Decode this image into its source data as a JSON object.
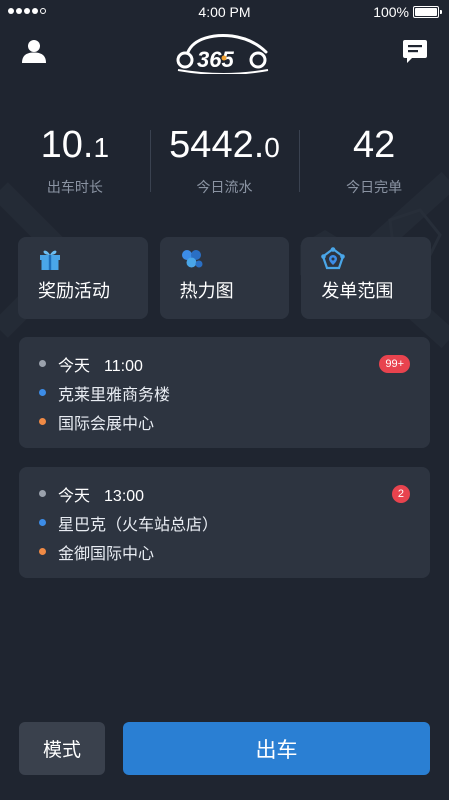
{
  "status_bar": {
    "time": "4:00 PM",
    "battery": "100%"
  },
  "header": {
    "logo_text": "365",
    "user_icon": "user-icon",
    "message_icon": "message-icon"
  },
  "stats": [
    {
      "value_int": "10.",
      "value_dec": "1",
      "label": "出车时长"
    },
    {
      "value_int": "5442.",
      "value_dec": "0",
      "label": "今日流水"
    },
    {
      "value_int": "42",
      "value_dec": "",
      "label": "今日完单"
    }
  ],
  "tiles": [
    {
      "label": "奖励活动",
      "icon": "gift-icon",
      "color": "#4aa6e8"
    },
    {
      "label": "热力图",
      "icon": "heatmap-icon",
      "color": "#3c8ce7"
    },
    {
      "label": "发单范围",
      "icon": "range-icon",
      "color": "#3c8ce7"
    }
  ],
  "orders": [
    {
      "day": "今天",
      "time": "11:00",
      "badge": "99+",
      "from": "克莱里雅商务楼",
      "to": "国际会展中心"
    },
    {
      "day": "今天",
      "time": "13:00",
      "badge": "2",
      "from": "星巴克（火车站总店）",
      "to": "金御国际中心"
    }
  ],
  "bottom": {
    "mode_label": "模式",
    "go_label": "出车"
  },
  "colors": {
    "background": "#1f2530",
    "card": "#2d3440",
    "primary": "#2a7fd3",
    "badge": "#e8434e",
    "from_dot": "#3c8ce7",
    "to_dot": "#f08a45"
  }
}
